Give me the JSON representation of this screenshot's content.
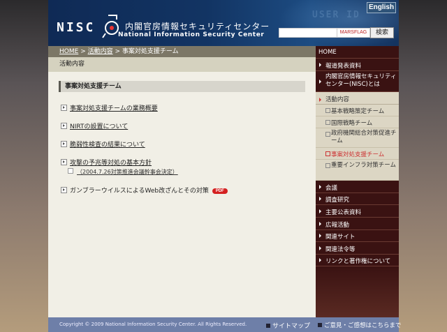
{
  "header": {
    "english": "English",
    "logo_nisc": "NISC",
    "logo_jp": "内閣官房情報セキュリティセンター",
    "logo_en": "National Information Security Center",
    "search_placeholder": "",
    "marsflag": "MARSFLAG",
    "search_button": "検索"
  },
  "breadcrumb": {
    "home": "HOME",
    "sep": ">",
    "activities": "活動内容",
    "current": "事案対処支援チーム"
  },
  "section_title": "活動内容",
  "content": {
    "heading": "事案対処支援チーム",
    "items": [
      "事案対処支援チームの業務概要",
      "NIRTの設置について",
      "脆弱性検査の結果について",
      "攻撃の予兆等対処の基本方針",
      "ガンブラーウイルスによるWeb改ざんとその対策"
    ],
    "subitem": "（2004.7.26対策推進会議幹事会決定）",
    "pdf": "PDF"
  },
  "sidebar": {
    "home": "HOME",
    "items": [
      "報道発表資料",
      "内閣官房情報セキュリティセンター(NISC)とは",
      "活動内容"
    ],
    "subitems": [
      "基本戦略策定チーム",
      "国際戦略チーム",
      "政府機関総合対策促進チーム",
      "事案対処支援チーム",
      "重要インフラ対策チーム"
    ],
    "items2": [
      "会議",
      "調査研究",
      "主要公表資料",
      "広報活動",
      "関連サイト",
      "関連法令等",
      "リンクと著作権について"
    ]
  },
  "footer": {
    "copyright": "Copyright © 2009 National Information Security Center. All Rights Reserved.",
    "sitemap": "サイトマップ",
    "feedback": "ご意見・ご感想はこちらまで"
  },
  "colors": {
    "header": "#123463",
    "sidebar": "#3a1212",
    "footer": "#6e7fa8",
    "active": "#cc3333"
  }
}
